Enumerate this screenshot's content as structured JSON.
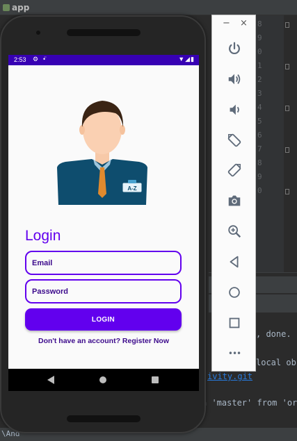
{
  "ide": {
    "project_name": "app",
    "line_numbers": [
      "8",
      "9",
      "0",
      "1",
      "2",
      "3",
      "4",
      "5",
      "6",
      "7",
      "8",
      "9",
      "0"
    ],
    "console_lines": [
      ", done.",
      "local ob",
      "ivity.git",
      "n 'master' from 'or"
    ],
    "status_text": "\\And"
  },
  "emulator": {
    "minimize_label": "−",
    "close_label": "×",
    "more_label": "•••",
    "buttons": [
      "power-icon",
      "volume-up-icon",
      "volume-down-icon",
      "rotate-left-icon",
      "rotate-right-icon",
      "camera-icon",
      "zoom-icon",
      "back-icon",
      "home-icon",
      "overview-icon",
      "more-icon"
    ]
  },
  "statusbar": {
    "time": "2:53",
    "status_icons": "▼◢▮"
  },
  "app": {
    "badge_text": "A-Z",
    "title": "Login",
    "email_placeholder": "Email",
    "password_placeholder": "Password",
    "login_button": "LOGIN",
    "register_text": "Don't have an account? Register Now"
  },
  "colors": {
    "primary": "#6200ee",
    "primary_dark": "#3700b3",
    "text_dark": "#3c0a8c"
  }
}
